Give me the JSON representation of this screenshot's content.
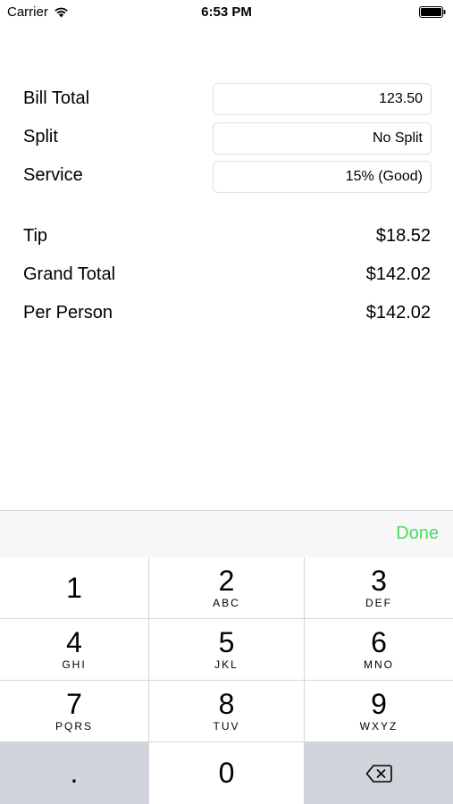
{
  "status_bar": {
    "carrier": "Carrier",
    "time": "6:53 PM"
  },
  "form": {
    "bill_total_label": "Bill Total",
    "bill_total_value": "123.50",
    "split_label": "Split",
    "split_value": "No Split",
    "service_label": "Service",
    "service_value": "15% (Good)"
  },
  "results": {
    "tip_label": "Tip",
    "tip_value": "$18.52",
    "grand_total_label": "Grand Total",
    "grand_total_value": "$142.02",
    "per_person_label": "Per Person",
    "per_person_value": "$142.02"
  },
  "keyboard": {
    "done_label": "Done",
    "done_color": "#4cd964",
    "keys": [
      {
        "digit": "1",
        "letters": ""
      },
      {
        "digit": "2",
        "letters": "ABC"
      },
      {
        "digit": "3",
        "letters": "DEF"
      },
      {
        "digit": "4",
        "letters": "GHI"
      },
      {
        "digit": "5",
        "letters": "JKL"
      },
      {
        "digit": "6",
        "letters": "MNO"
      },
      {
        "digit": "7",
        "letters": "PQRS"
      },
      {
        "digit": "8",
        "letters": "TUV"
      },
      {
        "digit": "9",
        "letters": "WXYZ"
      },
      {
        "digit": ".",
        "letters": ""
      },
      {
        "digit": "0",
        "letters": ""
      }
    ],
    "delete_icon": "delete-backspace-icon"
  }
}
